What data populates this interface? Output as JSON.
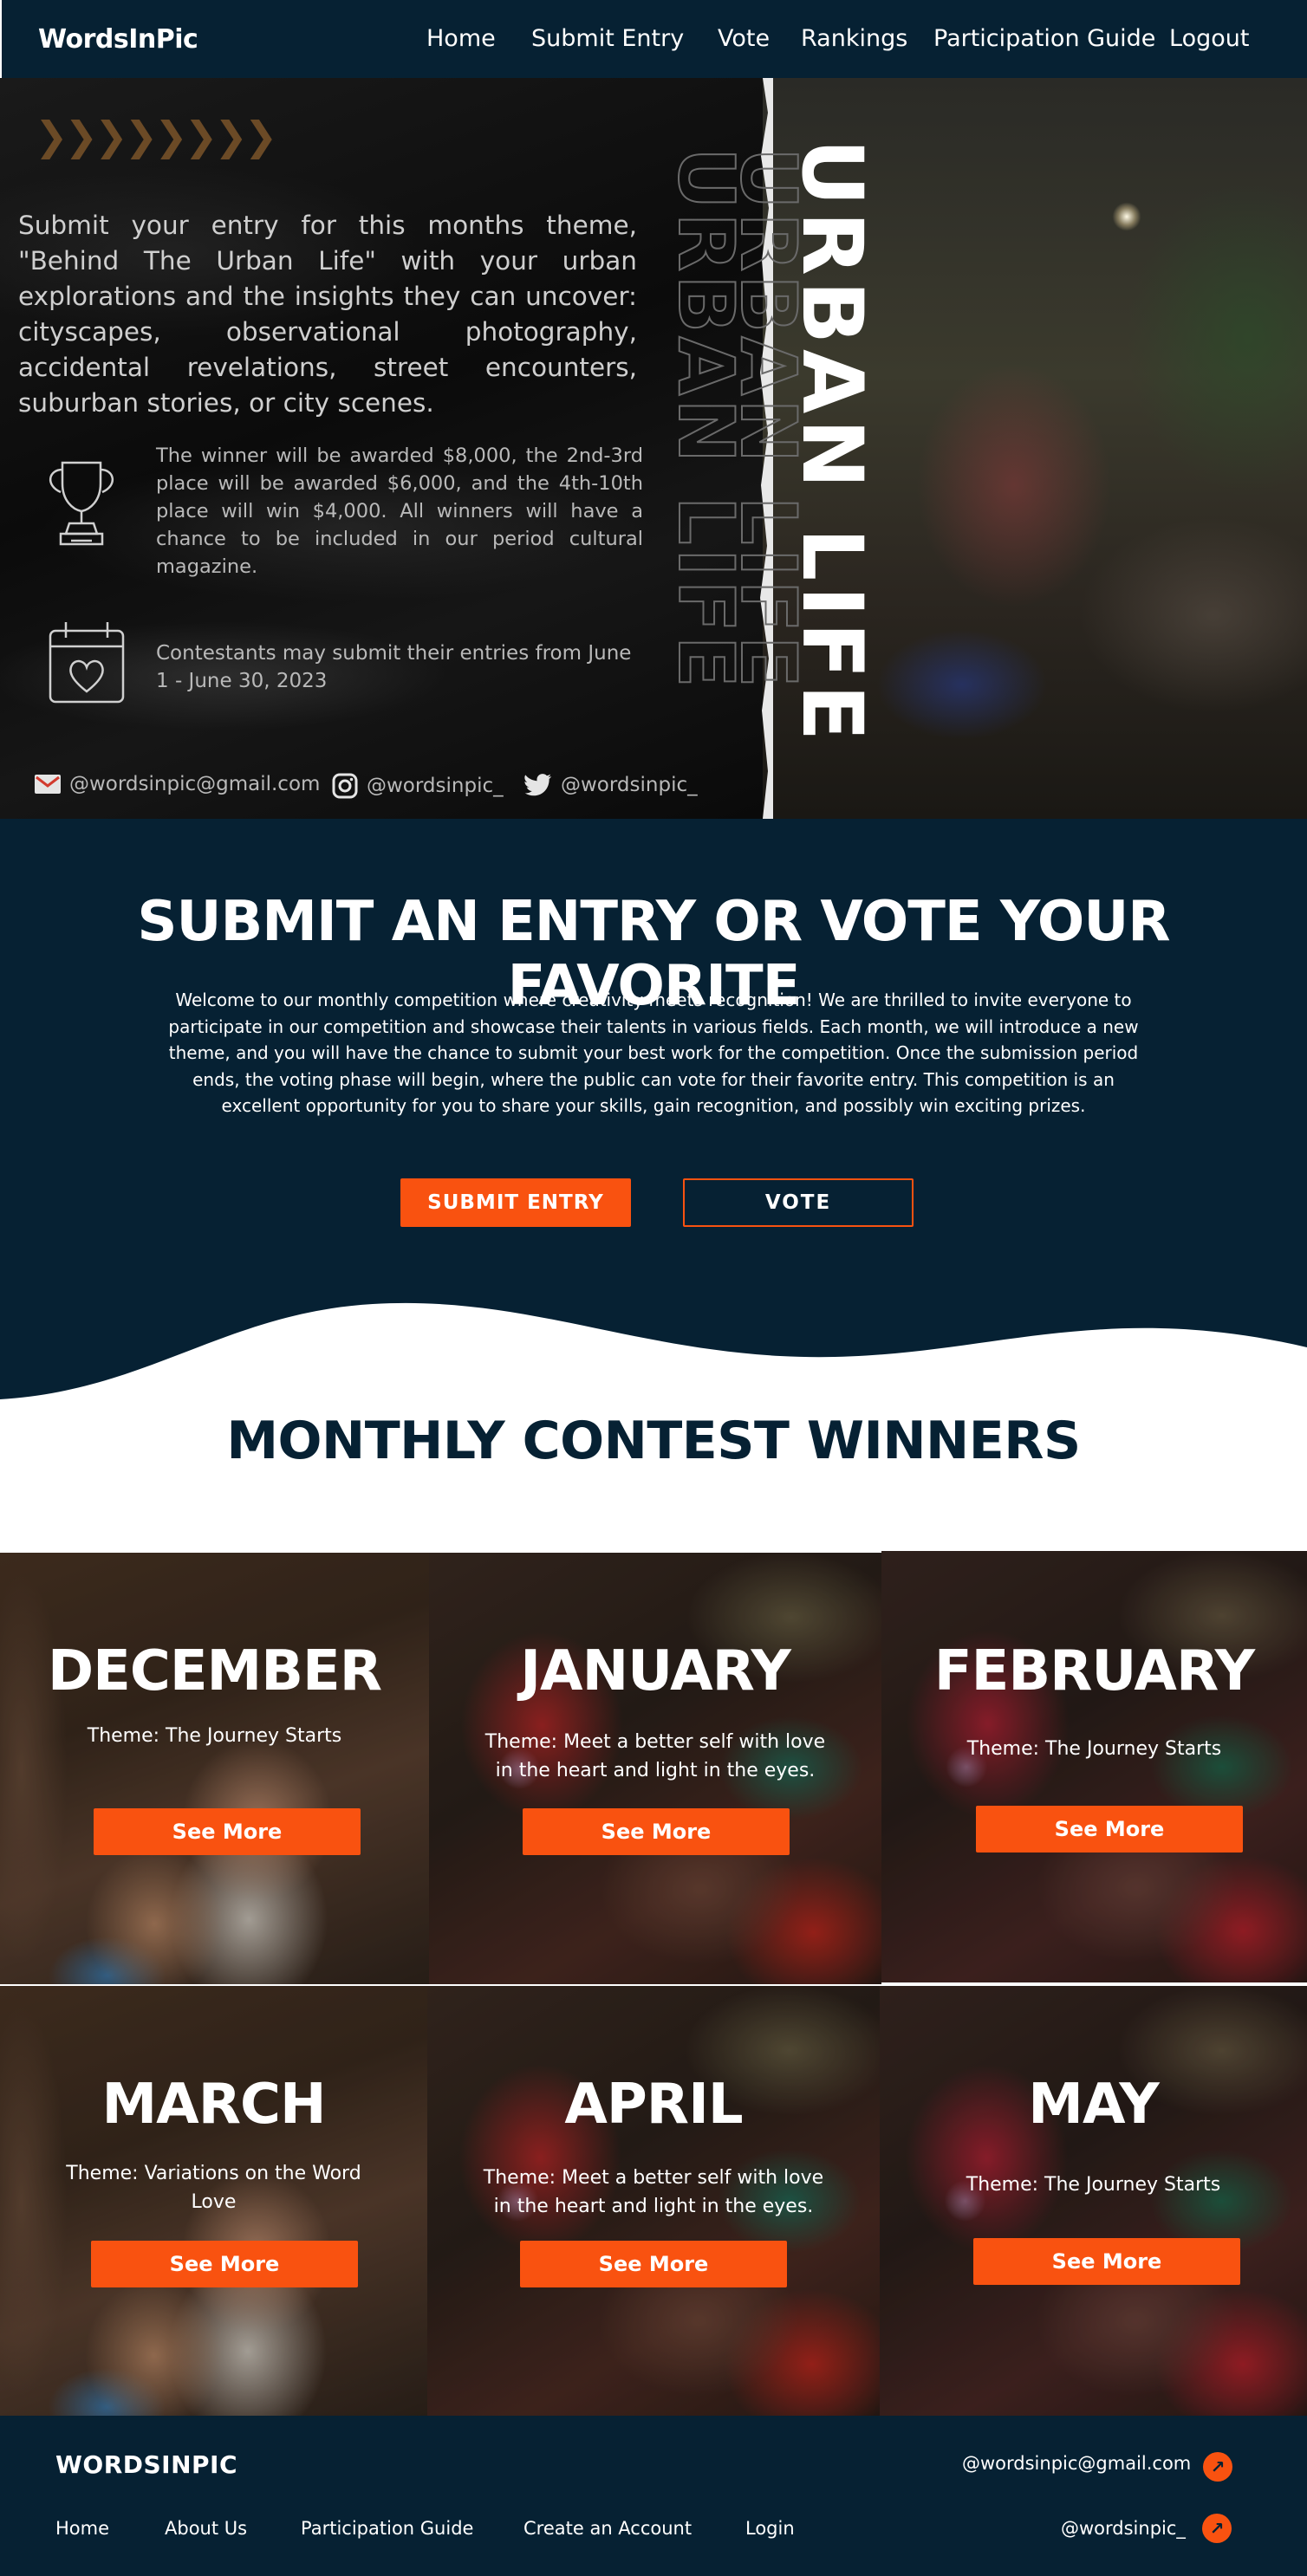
{
  "nav": {
    "brand": "WordsInPic",
    "items": [
      "Home",
      "Submit Entry",
      "Vote",
      "Rankings",
      "Participation Guide",
      "Logout"
    ]
  },
  "hero": {
    "intro": "Submit your entry for this months theme, \"Behind The Urban Life\" with your urban explorations and the insights they can uncover: cityscapes, observational photography, accidental revelations, street encounters, suburban stories, or city scenes.",
    "prize": "The winner will be awarded $8,000, the 2nd-3rd place will be awarded $6,000, and the 4th-10th place will win $4,000. All winners will have a chance to be included in our period cultural magazine.",
    "dates": "Contestants may submit their entries from June 1 - June 30, 2023",
    "poster_title": "URBAN LIFE",
    "social": {
      "email": "@wordsinpic@gmail.com",
      "instagram": "@wordsinpic_",
      "twitter": "@wordsinpic_"
    },
    "icons": [
      "trophy-icon",
      "calendar-heart-icon",
      "mail-icon",
      "instagram-icon",
      "twitter-icon"
    ]
  },
  "submit": {
    "title": "SUBMIT AN ENTRY OR VOTE YOUR FAVORITE",
    "description": "Welcome to our monthly competition where creativity meets recognition! We are thrilled to invite everyone to participate in our competition and showcase their talents in various fields. Each month, we will introduce a new theme, and you will have the chance to submit your best work for the competition. Once the submission period ends, the voting phase will begin, where the public can vote for their favorite entry. This competition is an excellent opportunity for you to share your skills, gain recognition, and possibly win exciting prizes.",
    "submit_label": "SUBMIT ENTRY",
    "vote_label": "VOTE"
  },
  "winners": {
    "title": "MONTHLY CONTEST WINNERS",
    "see_more": "See More",
    "cards": [
      {
        "month": "DECEMBER",
        "theme": "Theme: The Journey Starts"
      },
      {
        "month": "JANUARY",
        "theme": "Theme: Meet a better self with love in the heart and light in the eyes."
      },
      {
        "month": "FEBRUARY",
        "theme": "Theme: The Journey Starts"
      },
      {
        "month": "MARCH",
        "theme": "Theme: Variations on the Word Love"
      },
      {
        "month": "APRIL",
        "theme": "Theme: Meet a better self with love in the heart and light in the eyes."
      },
      {
        "month": "MAY",
        "theme": "Theme: The Journey Starts"
      }
    ]
  },
  "footer": {
    "brand": "WORDSINPIC",
    "links": [
      "Home",
      "About Us",
      "Participation Guide",
      "Create an Account",
      "Login"
    ],
    "email": "@wordsinpic@gmail.com",
    "handle": "@wordsinpic_"
  },
  "colors": {
    "navy": "#062133",
    "accent": "#f95210",
    "white": "#ffffff"
  }
}
